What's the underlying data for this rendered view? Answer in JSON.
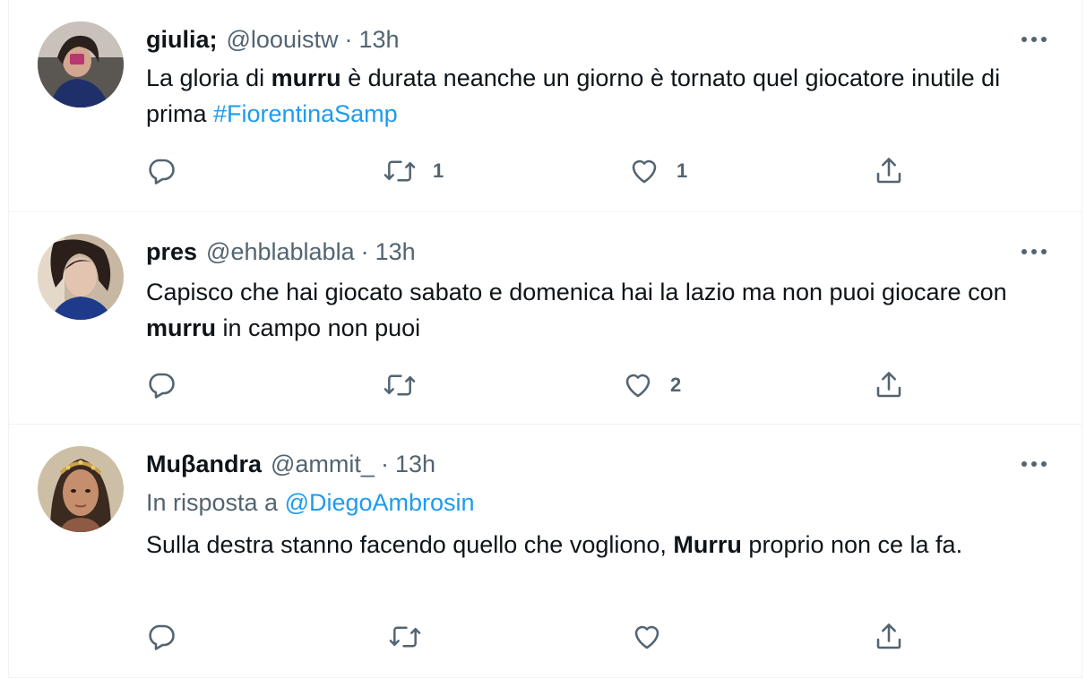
{
  "tweets": [
    {
      "name": "giulia;",
      "handle": "@loouistw",
      "dot": "·",
      "time": "13h",
      "text_1": "La gloria di ",
      "bold_1": "murru",
      "text_2": " è durata neanche un giorno è tornato quel giocatore inutile di prima ",
      "hashtag": "#FiorentinaSamp",
      "reply_count": "",
      "retweet_count": "1",
      "like_count": "1"
    },
    {
      "name": "pres",
      "handle": "@ehblablabla",
      "dot": "·",
      "time": "13h",
      "text_1": "Capisco che hai giocato sabato e domenica hai la lazio ma non puoi giocare con ",
      "bold_1": "murru",
      "text_2": " in campo non puoi",
      "reply_count": "",
      "retweet_count": "",
      "like_count": "2"
    },
    {
      "name": "Muβandra",
      "handle": "@ammit_",
      "dot": "·",
      "time": "13h",
      "reply_label": "In risposta a ",
      "reply_handle": "@DiegoAmbrosin",
      "text_1": "Sulla destra stanno facendo quello che vogliono, ",
      "bold_1": "Murru",
      "text_2": " proprio non ce la fa.",
      "reply_count": "",
      "retweet_count": "",
      "like_count": ""
    }
  ],
  "icons": {
    "reply": "reply-icon",
    "retweet": "retweet-icon",
    "like": "heart-icon",
    "share": "share-icon",
    "more": "more-icon"
  },
  "colors": {
    "text": "#0f1419",
    "secondary": "#536471",
    "accent": "#1d9bf0",
    "border": "#eff3f4"
  }
}
